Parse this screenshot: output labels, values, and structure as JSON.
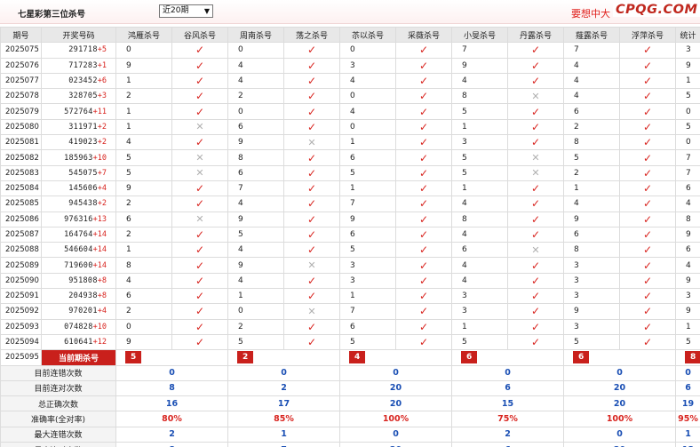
{
  "header": {
    "title": "七星彩第三位杀号",
    "period_select": "近20期",
    "promo_text": "要想中大",
    "logo": "CPQG.COM"
  },
  "columns": [
    "期号",
    "开奖号码",
    "鸿雁杀号",
    "谷风杀号",
    "周南杀号",
    "荡之杀号",
    "苶以杀号",
    "采薇杀号",
    "小旻杀号",
    "丹露杀号",
    "薤露杀号",
    "浮萍杀号",
    "统计"
  ],
  "rows": [
    {
      "period": "2025075",
      "draw": "291718",
      "plus": "+5",
      "v": [
        "0",
        "0",
        "0",
        "7",
        "7",
        "3",
        "5",
        "0",
        "0",
        "0"
      ],
      "m": [
        "y",
        "y",
        "y",
        "y",
        "y",
        "y",
        "y",
        "y",
        "y",
        "y"
      ],
      "stat": "全对"
    },
    {
      "period": "2025076",
      "draw": "717283",
      "plus": "+1",
      "v": [
        "9",
        "4",
        "3",
        "9",
        "4",
        "9",
        "8",
        "0",
        "0",
        "6"
      ],
      "m": [
        "y",
        "y",
        "y",
        "y",
        "y",
        "y",
        "y",
        "y",
        "y",
        "y"
      ],
      "stat": "全对"
    },
    {
      "period": "2025077",
      "draw": "023452",
      "plus": "+6",
      "v": [
        "1",
        "4",
        "4",
        "4",
        "4",
        "1",
        "1",
        "9",
        "7",
        "7"
      ],
      "m": [
        "y",
        "y",
        "y",
        "y",
        "y",
        "y",
        "y",
        "y",
        "y",
        "y"
      ],
      "stat": "全对"
    },
    {
      "period": "2025078",
      "draw": "328705",
      "plus": "+3",
      "v": [
        "2",
        "2",
        "0",
        "8",
        "4",
        "5",
        "9",
        "6",
        "2",
        "0"
      ],
      "m": [
        "y",
        "y",
        "y",
        "n",
        "y",
        "y",
        "y",
        "y",
        "y",
        "y"
      ],
      "stat": "9"
    },
    {
      "period": "2025079",
      "draw": "572764",
      "plus": "+11",
      "v": [
        "1",
        "0",
        "4",
        "5",
        "6",
        "0",
        "1",
        "2",
        "5",
        "0"
      ],
      "m": [
        "y",
        "y",
        "y",
        "y",
        "y",
        "y",
        "y",
        "n",
        "y",
        "y"
      ],
      "stat": "9"
    },
    {
      "period": "2025080",
      "draw": "311971",
      "plus": "+2",
      "v": [
        "1",
        "6",
        "0",
        "1",
        "2",
        "5",
        "6",
        "7",
        "6",
        "1"
      ],
      "m": [
        "n",
        "y",
        "y",
        "y",
        "y",
        "y",
        "y",
        "y",
        "y",
        "n"
      ],
      "stat": "7"
    },
    {
      "period": "2025081",
      "draw": "419023",
      "plus": "+2",
      "v": [
        "4",
        "9",
        "1",
        "3",
        "8",
        "0",
        "2",
        "4",
        "4",
        "9"
      ],
      "m": [
        "y",
        "n",
        "y",
        "y",
        "y",
        "y",
        "y",
        "y",
        "y",
        "n"
      ],
      "stat": "8"
    },
    {
      "period": "2025082",
      "draw": "185963",
      "plus": "+10",
      "v": [
        "5",
        "8",
        "6",
        "5",
        "5",
        "7",
        "1",
        "4",
        "9",
        "7"
      ],
      "m": [
        "n",
        "y",
        "y",
        "n",
        "y",
        "y",
        "y",
        "y",
        "y",
        "y"
      ],
      "stat": "8"
    },
    {
      "period": "2025083",
      "draw": "545075",
      "plus": "+7",
      "v": [
        "5",
        "6",
        "5",
        "5",
        "2",
        "7",
        "2",
        "8",
        "3",
        "0"
      ],
      "m": [
        "n",
        "y",
        "y",
        "n",
        "y",
        "y",
        "y",
        "y",
        "y",
        "y"
      ],
      "stat": "8"
    },
    {
      "period": "2025084",
      "draw": "145606",
      "plus": "+4",
      "v": [
        "9",
        "7",
        "1",
        "1",
        "1",
        "6",
        "1",
        "1",
        "7",
        "5"
      ],
      "m": [
        "y",
        "y",
        "y",
        "y",
        "y",
        "y",
        "y",
        "y",
        "y",
        "n"
      ],
      "stat": "9"
    },
    {
      "period": "2025085",
      "draw": "945438",
      "plus": "+2",
      "v": [
        "2",
        "4",
        "7",
        "4",
        "4",
        "4",
        "6",
        "9",
        "6",
        "6"
      ],
      "m": [
        "y",
        "y",
        "y",
        "y",
        "y",
        "y",
        "y",
        "y",
        "y",
        "y"
      ],
      "stat": "全对"
    },
    {
      "period": "2025086",
      "draw": "976316",
      "plus": "+13",
      "v": [
        "6",
        "9",
        "9",
        "8",
        "9",
        "8",
        "3",
        "2",
        "8",
        "8"
      ],
      "m": [
        "n",
        "y",
        "y",
        "y",
        "y",
        "y",
        "y",
        "y",
        "y",
        "y"
      ],
      "stat": "9"
    },
    {
      "period": "2025087",
      "draw": "164764",
      "plus": "+14",
      "v": [
        "2",
        "5",
        "6",
        "4",
        "6",
        "9",
        "9",
        "0",
        "1",
        "2"
      ],
      "m": [
        "y",
        "y",
        "y",
        "y",
        "y",
        "y",
        "y",
        "y",
        "y",
        "y"
      ],
      "stat": "全对"
    },
    {
      "period": "2025088",
      "draw": "546604",
      "plus": "+14",
      "v": [
        "1",
        "4",
        "5",
        "6",
        "8",
        "6",
        "9",
        "9",
        "0",
        "1"
      ],
      "m": [
        "y",
        "y",
        "y",
        "n",
        "y",
        "n",
        "y",
        "y",
        "y",
        "y"
      ],
      "stat": "8"
    },
    {
      "period": "2025089",
      "draw": "719600",
      "plus": "+14",
      "v": [
        "8",
        "9",
        "3",
        "4",
        "3",
        "4",
        "5",
        "6",
        "2",
        "3"
      ],
      "m": [
        "y",
        "n",
        "y",
        "y",
        "y",
        "y",
        "y",
        "y",
        "y",
        "y"
      ],
      "stat": "9"
    },
    {
      "period": "2025090",
      "draw": "951808",
      "plus": "+8",
      "v": [
        "4",
        "4",
        "3",
        "4",
        "3",
        "9",
        "8",
        "4",
        "8",
        "4"
      ],
      "m": [
        "y",
        "y",
        "y",
        "y",
        "y",
        "y",
        "y",
        "y",
        "y",
        "y"
      ],
      "stat": "全对"
    },
    {
      "period": "2025091",
      "draw": "204938",
      "plus": "+8",
      "v": [
        "6",
        "1",
        "1",
        "3",
        "3",
        "3",
        "5",
        "7",
        "7",
        "9"
      ],
      "m": [
        "y",
        "y",
        "y",
        "y",
        "y",
        "y",
        "y",
        "y",
        "y",
        "y"
      ],
      "stat": "全对"
    },
    {
      "period": "2025092",
      "draw": "970201",
      "plus": "+4",
      "v": [
        "2",
        "0",
        "7",
        "3",
        "9",
        "9",
        "6",
        "6",
        "2",
        "3"
      ],
      "m": [
        "y",
        "n",
        "y",
        "y",
        "y",
        "y",
        "y",
        "y",
        "y",
        "y"
      ],
      "stat": "9"
    },
    {
      "period": "2025093",
      "draw": "074828",
      "plus": "+10",
      "v": [
        "0",
        "2",
        "6",
        "1",
        "3",
        "1",
        "5",
        "3",
        "2",
        "7"
      ],
      "m": [
        "y",
        "y",
        "y",
        "y",
        "y",
        "y",
        "y",
        "y",
        "y",
        "y"
      ],
      "stat": "全对"
    },
    {
      "period": "2025094",
      "draw": "610641",
      "plus": "+12",
      "v": [
        "9",
        "5",
        "5",
        "5",
        "5",
        "5",
        "5",
        "0",
        "0",
        "6"
      ],
      "m": [
        "y",
        "y",
        "y",
        "y",
        "y",
        "y",
        "y",
        "n",
        "n",
        "y"
      ],
      "stat": "8"
    }
  ],
  "current": {
    "period": "2025095",
    "label": "当前期杀号",
    "values": [
      "5",
      "2",
      "4",
      "6",
      "6",
      "8",
      "8",
      "0",
      "0",
      "3"
    ]
  },
  "stats": [
    {
      "label": "目前连错次数",
      "values": [
        "0",
        "0",
        "0",
        "0",
        "0",
        "0",
        "0",
        "1",
        "1",
        "0",
        "1"
      ],
      "kind": "n"
    },
    {
      "label": "目前连对次数",
      "values": [
        "8",
        "2",
        "20",
        "6",
        "20",
        "6",
        "20",
        "0",
        "0",
        "10",
        "0"
      ],
      "kind": "n"
    },
    {
      "label": "总正确次数",
      "values": [
        "16",
        "17",
        "20",
        "15",
        "20",
        "19",
        "20",
        "18",
        "19",
        "17",
        "8"
      ],
      "kind": "n"
    },
    {
      "label": "准确率(全对率)",
      "values": [
        "80%",
        "85%",
        "100%",
        "75%",
        "100%",
        "95%",
        "100%",
        "90%",
        "95%",
        "85%",
        "40%"
      ],
      "kind": "r"
    },
    {
      "label": "最大连错次数",
      "values": [
        "2",
        "1",
        "0",
        "2",
        "0",
        "1",
        "0",
        "1",
        "1",
        "2",
        "7"
      ],
      "kind": "n"
    },
    {
      "label": "最大连对次数",
      "values": [
        "8",
        "7",
        "20",
        "6",
        "20",
        "13",
        "20",
        "14",
        "19",
        "10",
        "3"
      ],
      "kind": "n"
    }
  ],
  "colors": {
    "accent": "#c9201c",
    "check": "#d8241f",
    "cross": "#b0b0b0",
    "stat_blue": "#1a4fb4"
  },
  "icons": {
    "yes": "check-icon",
    "no": "cross-icon"
  }
}
